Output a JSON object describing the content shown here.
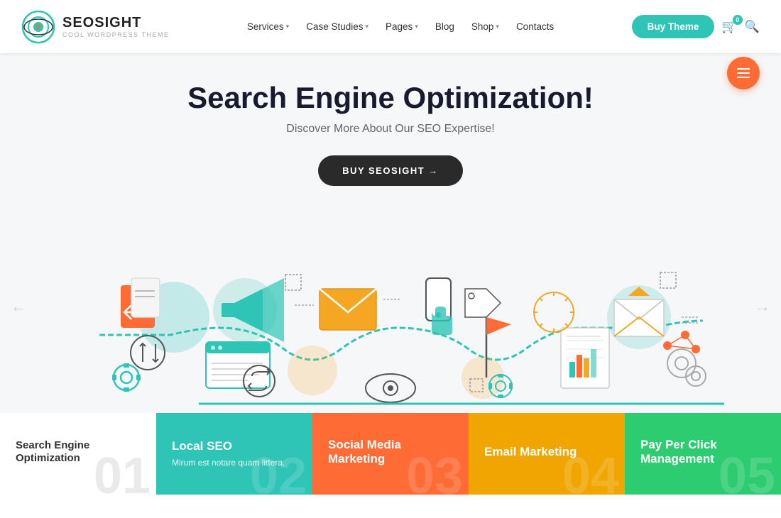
{
  "header": {
    "logo": {
      "title": "SEOSIGHT",
      "subtitle": "COOL WORDPRESS THEME"
    },
    "nav": [
      {
        "label": "Services",
        "has_dropdown": true
      },
      {
        "label": "Case Studies",
        "has_dropdown": true
      },
      {
        "label": "Pages",
        "has_dropdown": true
      },
      {
        "label": "Blog",
        "has_dropdown": false
      },
      {
        "label": "Shop",
        "has_dropdown": true
      },
      {
        "label": "Contacts",
        "has_dropdown": false
      }
    ],
    "buy_button": "Buy Theme",
    "cart_count": "0"
  },
  "hero": {
    "title": "Search Engine Optimization!",
    "subtitle": "Discover More About Our SEO Expertise!",
    "cta_label": "BUY SEOSIGHT →"
  },
  "bottom_cards": [
    {
      "id": "search-engine-optimization",
      "title": "Search Engine Optimization",
      "desc": "",
      "num": "01",
      "style": "white"
    },
    {
      "id": "local-seo",
      "title": "Local SEO",
      "desc": "Mirum est notare quam littera.",
      "num": "02",
      "style": "teal"
    },
    {
      "id": "social-media-marketing",
      "title": "Social Media Marketing",
      "desc": "",
      "num": "03",
      "style": "orange"
    },
    {
      "id": "email-marketing",
      "title": "Email Marketing",
      "desc": "",
      "num": "04",
      "style": "yellow"
    },
    {
      "id": "pay-per-click",
      "title": "Pay Per Click Management",
      "desc": "",
      "num": "05",
      "style": "green"
    }
  ],
  "illustration": {
    "arrow_left": "←",
    "arrow_right": "→"
  }
}
